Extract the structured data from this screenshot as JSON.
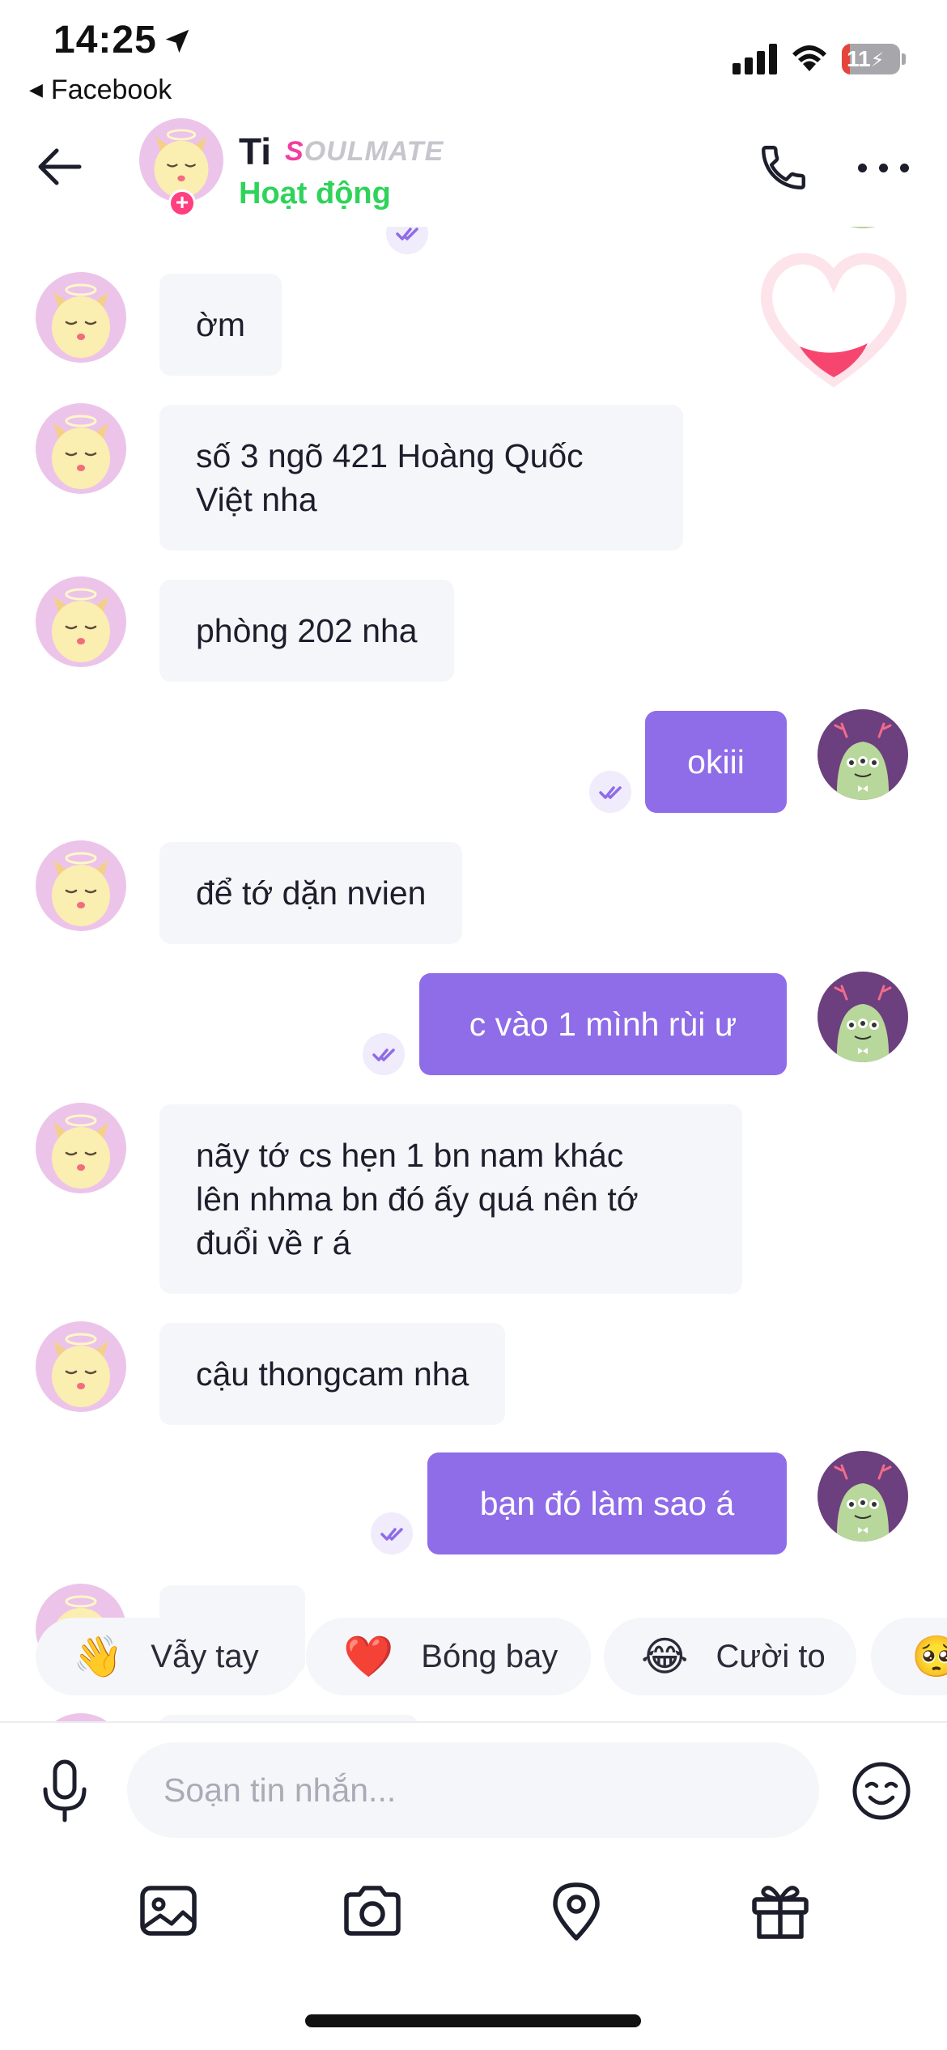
{
  "status_bar": {
    "time": "14:25",
    "back_app": "Facebook",
    "battery": "11"
  },
  "header": {
    "name": "Ti",
    "badge_first": "S",
    "badge_rest": "OULMATE",
    "status": "Hoạt động"
  },
  "messages": [
    {
      "from": "them",
      "text": "ờm"
    },
    {
      "from": "them",
      "lines": [
        "số 3 ngõ 421 Hoàng Quốc",
        "Việt nha"
      ]
    },
    {
      "from": "them",
      "text": "phòng 202 nha"
    },
    {
      "from": "me",
      "text": "okiii"
    },
    {
      "from": "them",
      "text": "để tớ dặn nvien"
    },
    {
      "from": "me",
      "text": "c vào 1 mình rùi ư"
    },
    {
      "from": "them",
      "lines": [
        "nãy tớ cs hẹn 1 bn nam khác",
        "lên nhma bn đó ấy quá nên tớ",
        "đuổi về r á"
      ]
    },
    {
      "from": "them",
      "text": "cậu thongcam nha"
    },
    {
      "from": "me",
      "text": "bạn đó làm sao á"
    }
  ],
  "quick_reactions": [
    {
      "emoji": "👋",
      "label": "Vẫy tay"
    },
    {
      "emoji": "❤️",
      "label": "Bóng bay"
    },
    {
      "emoji": "😂",
      "label": "Cười to"
    },
    {
      "emoji": "🥺",
      "label": ""
    }
  ],
  "composer": {
    "placeholder": "Soạn tin nhắn...",
    "value": ""
  },
  "toolbar_icons": [
    "image-icon",
    "camera-icon",
    "location-pin-icon",
    "gift-icon"
  ],
  "colors": {
    "accent": "#8f6ce8",
    "incoming_bubble": "#f5f6f9",
    "online": "#2fd35a",
    "badge_pink": "#f13ea0"
  }
}
